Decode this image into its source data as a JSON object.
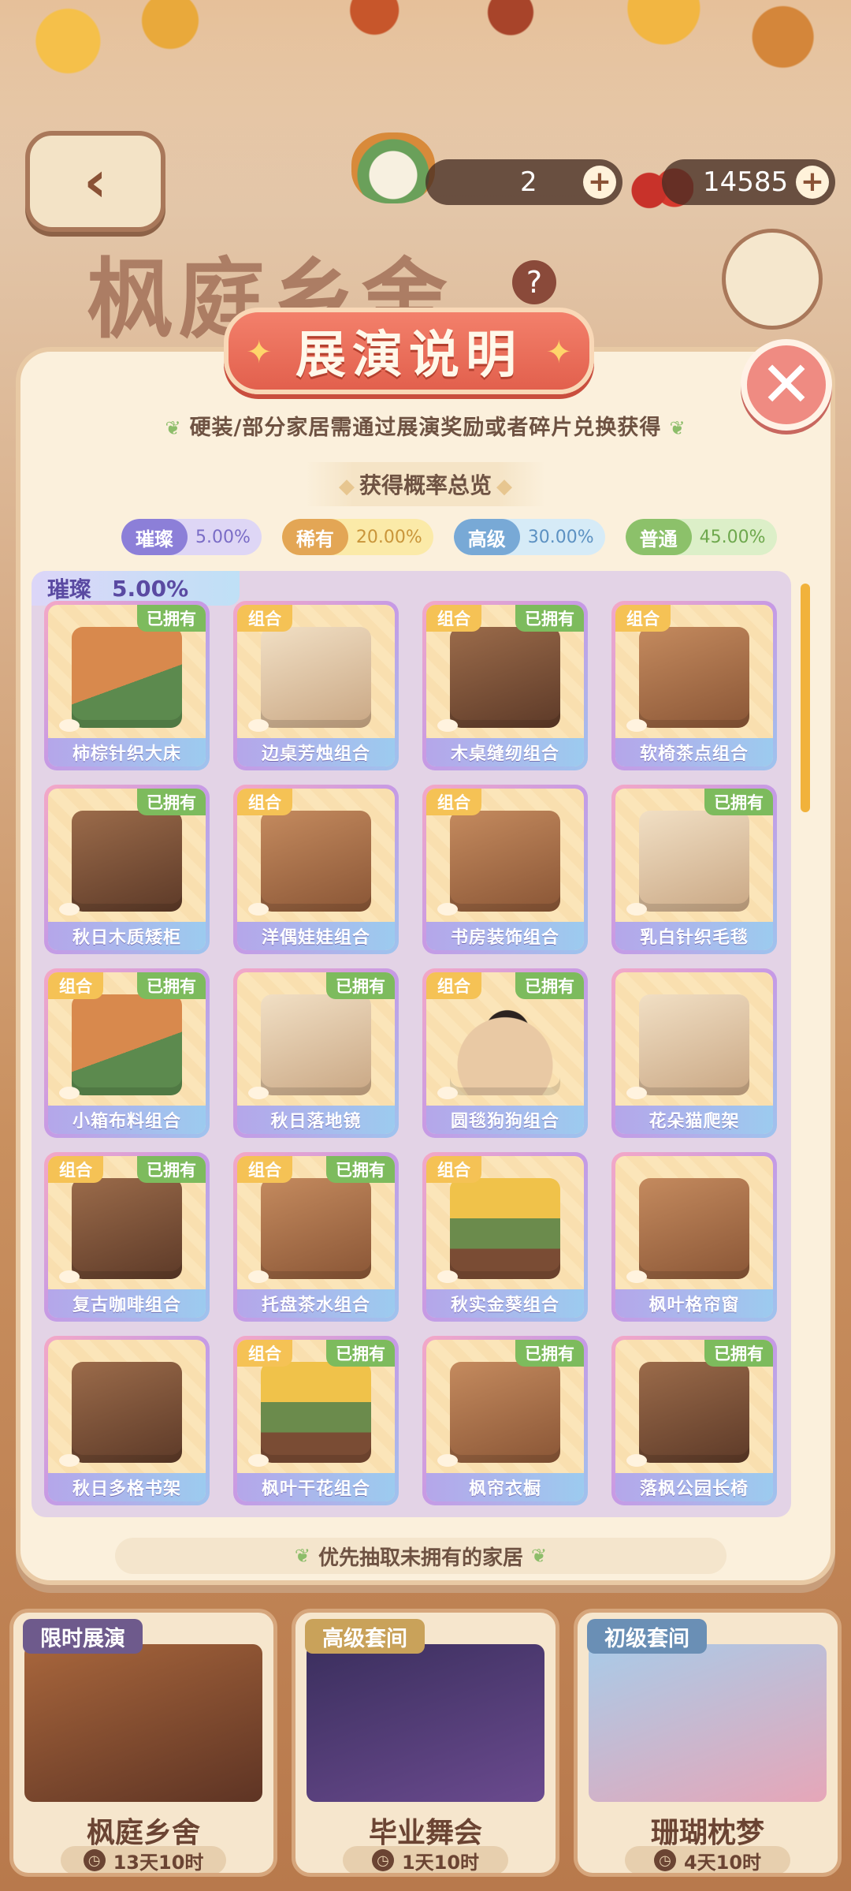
{
  "header": {
    "token_count": "2",
    "cherry_count": "14585",
    "bg_title": "枫庭乡舍",
    "help_glyph": "?"
  },
  "modal": {
    "title": "展演说明",
    "description": "硬装/部分家居需通过展演奖励或者碎片兑换获得",
    "subheading": "获得概率总览",
    "rates": [
      {
        "name": "璀璨",
        "pct": "5.00%"
      },
      {
        "name": "稀有",
        "pct": "20.00%"
      },
      {
        "name": "高级",
        "pct": "30.00%"
      },
      {
        "name": "普通",
        "pct": "45.00%"
      }
    ],
    "tier": {
      "name": "璀璨",
      "pct": "5.00%"
    },
    "owned_label": "已拥有",
    "combo_label": "组合",
    "items": [
      {
        "label": "柿棕针织大床",
        "owned": true,
        "combo": false
      },
      {
        "label": "边桌芳烛组合",
        "owned": false,
        "combo": true
      },
      {
        "label": "木桌缝纫组合",
        "owned": true,
        "combo": true
      },
      {
        "label": "软椅茶点组合",
        "owned": false,
        "combo": true
      },
      {
        "label": "秋日木质矮柜",
        "owned": true,
        "combo": false
      },
      {
        "label": "洋偶娃娃组合",
        "owned": false,
        "combo": true
      },
      {
        "label": "书房装饰组合",
        "owned": false,
        "combo": true
      },
      {
        "label": "乳白针织毛毯",
        "owned": true,
        "combo": false
      },
      {
        "label": "小箱布料组合",
        "owned": true,
        "combo": true
      },
      {
        "label": "秋日落地镜",
        "owned": true,
        "combo": false
      },
      {
        "label": "圆毯狗狗组合",
        "owned": true,
        "combo": true
      },
      {
        "label": "花朵猫爬架",
        "owned": false,
        "combo": false
      },
      {
        "label": "复古咖啡组合",
        "owned": true,
        "combo": true
      },
      {
        "label": "托盘茶水组合",
        "owned": true,
        "combo": true
      },
      {
        "label": "秋实金葵组合",
        "owned": false,
        "combo": true
      },
      {
        "label": "枫叶格帘窗",
        "owned": false,
        "combo": false
      },
      {
        "label": "秋日多格书架",
        "owned": false,
        "combo": false
      },
      {
        "label": "枫叶干花组合",
        "owned": true,
        "combo": true
      },
      {
        "label": "枫帘衣橱",
        "owned": true,
        "combo": false
      },
      {
        "label": "落枫公园长椅",
        "owned": true,
        "combo": false
      }
    ],
    "priority_note": "优先抽取未拥有的家居"
  },
  "events": [
    {
      "tag": "限时展演",
      "name": "枫庭乡舍",
      "time": "13天10时",
      "tag_color": "#6e5a8c"
    },
    {
      "tag": "高级套间",
      "name": "毕业舞会",
      "time": "1天10时",
      "tag_color": "#c9a25a"
    },
    {
      "tag": "初级套间",
      "name": "珊瑚枕梦",
      "time": "4天10时",
      "tag_color": "#6a8fb5"
    }
  ]
}
